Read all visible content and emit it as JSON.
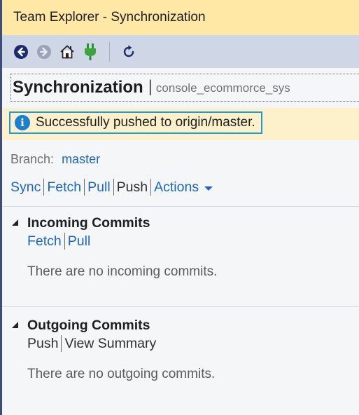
{
  "window": {
    "title": "Team Explorer - Synchronization"
  },
  "toolbar": {
    "buttons": [
      "back-icon",
      "forward-icon",
      "home-icon",
      "connect-icon",
      "refresh-icon"
    ]
  },
  "header": {
    "title": "Synchronization",
    "separator": "|",
    "repo": "console_ecommorce_sys"
  },
  "banner": {
    "message": "Successfully pushed to origin/master.",
    "icon": "info-icon"
  },
  "branch": {
    "label": "Branch:",
    "value": "master"
  },
  "actions": {
    "sync": "Sync",
    "fetch": "Fetch",
    "pull": "Pull",
    "push": "Push",
    "actions": "Actions"
  },
  "incoming": {
    "title": "Incoming Commits",
    "fetch": "Fetch",
    "pull": "Pull",
    "message": "There are no incoming commits."
  },
  "outgoing": {
    "title": "Outgoing Commits",
    "push": "Push",
    "view_summary": "View Summary",
    "message": "There are no outgoing commits."
  },
  "colors": {
    "title_bg": "#ffe8a6",
    "toolbar_bg": "#cfd6e5",
    "banner_bg": "#fdf1cc",
    "banner_border": "#1a9cd8",
    "link": "#1a66c8"
  }
}
